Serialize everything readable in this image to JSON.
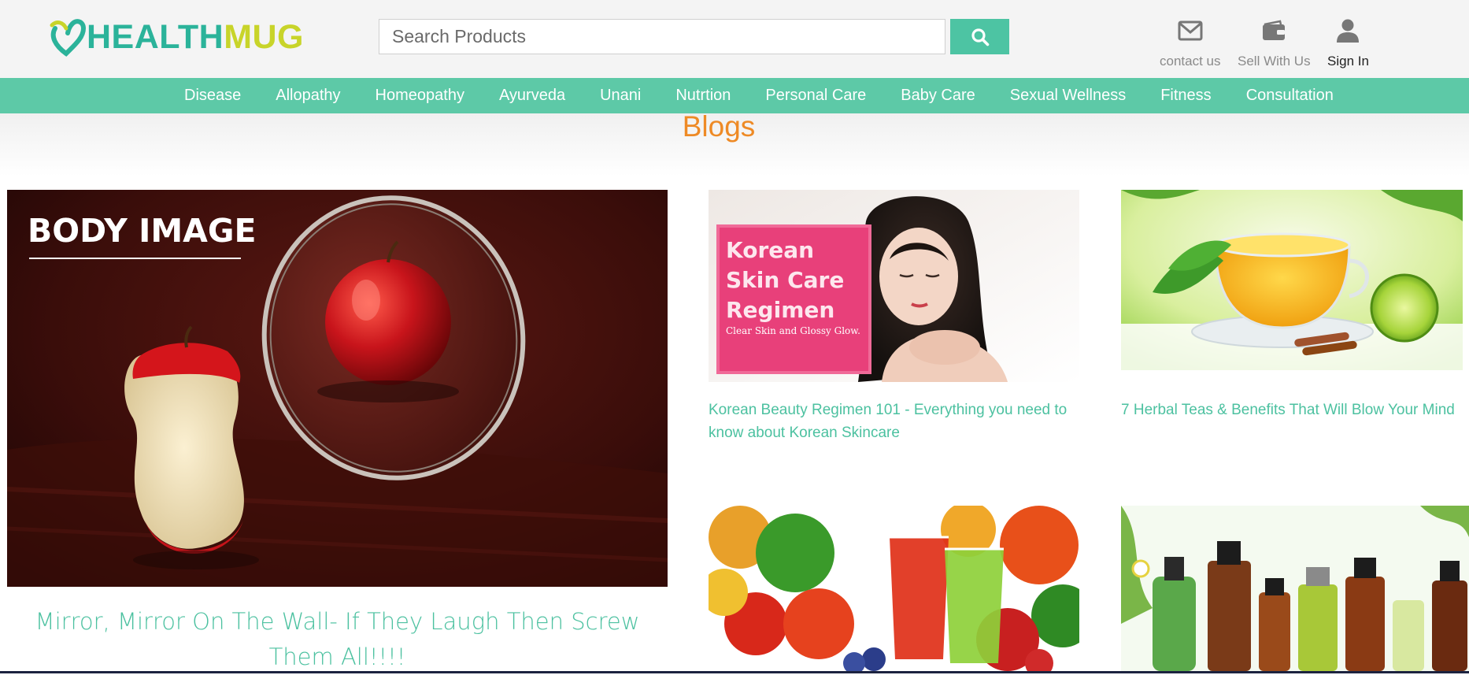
{
  "header": {
    "logo": {
      "part1": "HEALTH",
      "part2": "MUG"
    },
    "search": {
      "placeholder": "Search Products",
      "value": ""
    },
    "actions": {
      "contact": "contact us",
      "sell": "Sell With Us",
      "signin": "Sign In"
    }
  },
  "nav": {
    "items": [
      "Disease",
      "Allopathy",
      "Homeopathy",
      "Ayurveda",
      "Unani",
      "Nutrtion",
      "Personal Care",
      "Baby Care",
      "Sexual Wellness",
      "Fitness",
      "Consultation"
    ]
  },
  "main": {
    "title": "Blogs",
    "posts": [
      {
        "title": "Mirror, Mirror On The Wall- If They Laugh Then Screw Them All!!!!",
        "image_text": "BODY IMAGE"
      },
      {
        "title": "Korean Beauty Regimen 101 - Everything you need to know about Korean Skincare",
        "image_lines": [
          "Korean",
          "Skin Care",
          "Regimen"
        ],
        "image_sub": "Clear Skin and Glossy Glow."
      },
      {
        "title": "7 Herbal Teas & Benefits That Will Blow Your Mind"
      },
      {
        "title": ""
      },
      {
        "title": ""
      }
    ]
  },
  "colors": {
    "brand_green": "#2bb39a",
    "brand_lime": "#c8d42a",
    "nav_bg": "#5dc9a7",
    "search_button": "#4dc4a3",
    "title_orange": "#ee8a25",
    "link_green": "#4cc1a0"
  },
  "icons": {
    "logo": "heart-logo-icon",
    "search": "search-icon",
    "contact": "envelope-icon",
    "sell": "wallet-icon",
    "signin": "user-icon"
  }
}
